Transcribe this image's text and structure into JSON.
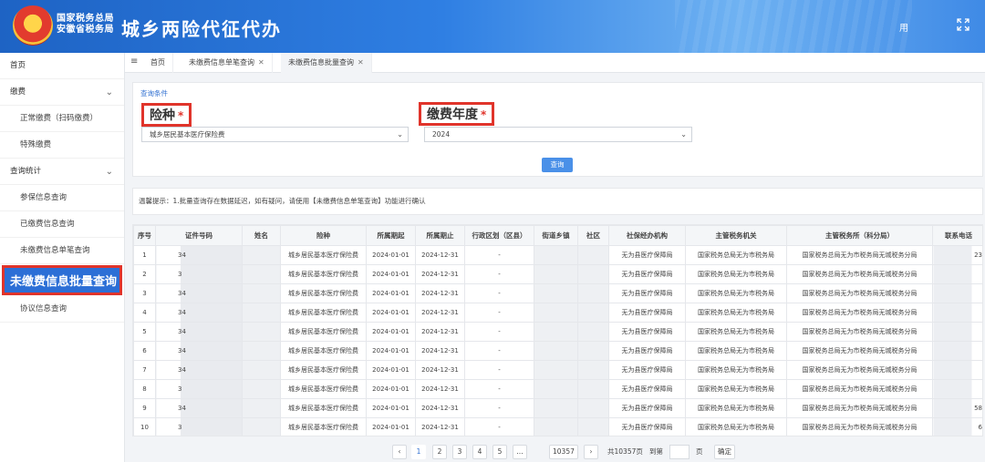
{
  "header": {
    "bureau_line1": "国家税务总局",
    "bureau_line2": "安徽省税务局",
    "title": "城乡两险代征代办",
    "user": "用",
    "fullscreen_icon": "expand-icon"
  },
  "sidebar": {
    "items": [
      {
        "label": "首页",
        "type": "item"
      },
      {
        "label": "缴费",
        "type": "group"
      },
      {
        "label": "正常缴费（扫码缴费）",
        "type": "child"
      },
      {
        "label": "特殊缴费",
        "type": "child"
      },
      {
        "label": "查询统计",
        "type": "group"
      },
      {
        "label": "参保信息查询",
        "type": "child"
      },
      {
        "label": "已缴费信息查询",
        "type": "child"
      },
      {
        "label": "未缴费信息单笔查询",
        "type": "child"
      },
      {
        "label": "未缴费信息批量查询",
        "type": "active"
      },
      {
        "label": "协议信息查询",
        "type": "child"
      }
    ]
  },
  "tabs": [
    {
      "label": "首页",
      "closable": false
    },
    {
      "label": "未缴费信息单笔查询",
      "closable": true
    },
    {
      "label": "未缴费信息批量查询",
      "closable": true
    }
  ],
  "query": {
    "caption": "查询条件",
    "insurance_label": "险种",
    "insurance_value": "城乡居民基本医疗保险费",
    "year_label": "缴费年度",
    "year_value": "2024",
    "required_mark": "*",
    "button": "查询"
  },
  "tip": "温馨提示：1.批量查询存在数据延迟，如有疑问，请使用【未缴费信息单笔查询】功能进行确认",
  "table": {
    "headers": [
      "序号",
      "证件号码",
      "姓名",
      "险种",
      "所属期起",
      "所属期止",
      "行政区划（区县）",
      "街道乡镇",
      "社区",
      "社保经办机构",
      "主管税务机关",
      "主管税务所（科分局）",
      "联系电话"
    ],
    "rows": [
      {
        "no": "1",
        "id": "34",
        "name": "",
        "type": "城乡居民基本医疗保险费",
        "start": "2024-01-01",
        "end": "2024-12-31",
        "district": "-",
        "street": "",
        "community": "",
        "agency": "无为县医疗保障局",
        "tax_org": "国家税务总局无为市税务局",
        "tax_office": "国家税务总局无为市税务局无城税务分局",
        "phone": "23"
      },
      {
        "no": "2",
        "id": "3",
        "name": "",
        "type": "城乡居民基本医疗保险费",
        "start": "2024-01-01",
        "end": "2024-12-31",
        "district": "-",
        "street": "",
        "community": "",
        "agency": "无为县医疗保障局",
        "tax_org": "国家税务总局无为市税务局",
        "tax_office": "国家税务总局无为市税务局无城税务分局",
        "phone": ""
      },
      {
        "no": "3",
        "id": "34",
        "name": "",
        "type": "城乡居民基本医疗保险费",
        "start": "2024-01-01",
        "end": "2024-12-31",
        "district": "-",
        "street": "",
        "community": "",
        "agency": "无为县医疗保障局",
        "tax_org": "国家税务总局无为市税务局",
        "tax_office": "国家税务总局无为市税务局无城税务分局",
        "phone": ""
      },
      {
        "no": "4",
        "id": "34",
        "name": "",
        "type": "城乡居民基本医疗保险费",
        "start": "2024-01-01",
        "end": "2024-12-31",
        "district": "-",
        "street": "",
        "community": "",
        "agency": "无为县医疗保障局",
        "tax_org": "国家税务总局无为市税务局",
        "tax_office": "国家税务总局无为市税务局无城税务分局",
        "phone": ""
      },
      {
        "no": "5",
        "id": "34",
        "name": "",
        "type": "城乡居民基本医疗保险费",
        "start": "2024-01-01",
        "end": "2024-12-31",
        "district": "-",
        "street": "",
        "community": "",
        "agency": "无为县医疗保障局",
        "tax_org": "国家税务总局无为市税务局",
        "tax_office": "国家税务总局无为市税务局无城税务分局",
        "phone": ""
      },
      {
        "no": "6",
        "id": "34",
        "name": "",
        "type": "城乡居民基本医疗保险费",
        "start": "2024-01-01",
        "end": "2024-12-31",
        "district": "-",
        "street": "",
        "community": "",
        "agency": "无为县医疗保障局",
        "tax_org": "国家税务总局无为市税务局",
        "tax_office": "国家税务总局无为市税务局无城税务分局",
        "phone": ""
      },
      {
        "no": "7",
        "id": "34",
        "name": "",
        "type": "城乡居民基本医疗保险费",
        "start": "2024-01-01",
        "end": "2024-12-31",
        "district": "-",
        "street": "",
        "community": "",
        "agency": "无为县医疗保障局",
        "tax_org": "国家税务总局无为市税务局",
        "tax_office": "国家税务总局无为市税务局无城税务分局",
        "phone": ""
      },
      {
        "no": "8",
        "id": "3",
        "name": "",
        "type": "城乡居民基本医疗保险费",
        "start": "2024-01-01",
        "end": "2024-12-31",
        "district": "-",
        "street": "",
        "community": "",
        "agency": "无为县医疗保障局",
        "tax_org": "国家税务总局无为市税务局",
        "tax_office": "国家税务总局无为市税务局无城税务分局",
        "phone": ""
      },
      {
        "no": "9",
        "id": "34",
        "name": "",
        "type": "城乡居民基本医疗保险费",
        "start": "2024-01-01",
        "end": "2024-12-31",
        "district": "-",
        "street": "",
        "community": "",
        "agency": "无为县医疗保障局",
        "tax_org": "国家税务总局无为市税务局",
        "tax_office": "国家税务总局无为市税务局无城税务分局",
        "phone": "58"
      },
      {
        "no": "10",
        "id": "3",
        "name": "",
        "type": "城乡居民基本医疗保险费",
        "start": "2024-01-01",
        "end": "2024-12-31",
        "district": "-",
        "street": "",
        "community": "",
        "agency": "无为县医疗保障局",
        "tax_org": "国家税务总局无为市税务局",
        "tax_office": "国家税务总局无为市税务局无城税务分局",
        "phone": "6"
      }
    ]
  },
  "pager": {
    "prev": "‹",
    "pages": [
      "1",
      "2",
      "3",
      "4",
      "5"
    ],
    "more": "…",
    "last": "10357",
    "next": "›",
    "total": "共10357页",
    "goto": "到第",
    "unit": "页",
    "confirm": "确定"
  }
}
